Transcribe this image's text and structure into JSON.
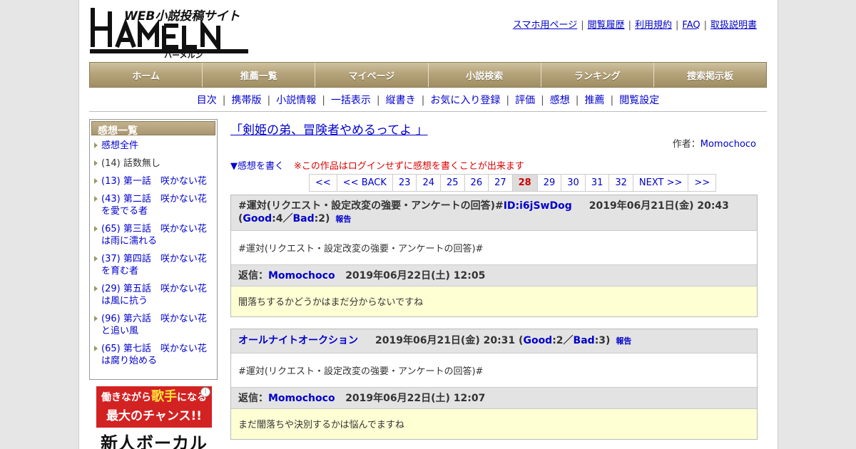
{
  "logo": {
    "tagline": "WEB小説投稿サイト",
    "name": "HAMELN",
    "kana": "ハーメルン"
  },
  "top_links": [
    "スマホ用ページ",
    "閲覧履歴",
    "利用規約",
    "FAQ",
    "取扱説明書"
  ],
  "global_nav": [
    "ホーム",
    "推薦一覧",
    "マイページ",
    "小説検索",
    "ランキング",
    "捜索掲示板"
  ],
  "sub_nav": [
    "目次",
    "携帯版",
    "小説情報",
    "一括表示",
    "縦書き",
    "お気に入り登録",
    "評価",
    "感想",
    "推薦",
    "閲覧設定"
  ],
  "sidebar": {
    "title": "感想一覧",
    "items": [
      {
        "label": "感想全件",
        "link": true
      },
      {
        "label": "(14) 話数無し",
        "link": false
      },
      {
        "label": "(13) 第一話　咲かない花",
        "link": true
      },
      {
        "label": "(43) 第二話　咲かない花を愛でる者",
        "link": true
      },
      {
        "label": "(65) 第三話　咲かない花は雨に濡れる",
        "link": true
      },
      {
        "label": "(37) 第四話　咲かない花を育む者",
        "link": true
      },
      {
        "label": "(29) 第五話　咲かない花は風に抗う",
        "link": true
      },
      {
        "label": "(96) 第六話　咲かない花と追い風",
        "link": true
      },
      {
        "label": "(65) 第七話　咲かない花は腐り始める",
        "link": true
      }
    ]
  },
  "ad": {
    "line1a": "働きながら",
    "line1b": "歌手",
    "line1c": "になる",
    "line2": "最大のチャンス!!",
    "line3": "新人ボーカル",
    "info": "i"
  },
  "work": {
    "title": "「剣姫の弟、冒険者やめるってよ 」",
    "author_label": "作者：",
    "author": "Momochoco",
    "write_link": "▼感想を書く",
    "notice": "※この作品はログインせずに感想を書くことが出来ます"
  },
  "pager": [
    "<<",
    "<< BACK",
    "23",
    "24",
    "25",
    "26",
    "27",
    "28",
    "29",
    "30",
    "31",
    "32",
    "NEXT >>",
    ">>"
  ],
  "pager_current": "28",
  "reviews": [
    {
      "head_text": "#運対(リクエスト・設定改変の強要・アンケートの回答)#",
      "user": "ID:i6jSwDog",
      "date": "2019年06月21日(金) 20:43",
      "good_label": "Good",
      "good": ":4／",
      "bad_label": "Bad",
      "bad": ":2)",
      "open_paren": "(",
      "report": "報告",
      "body": "#運対(リクエスト・設定改変の強要・アンケートの回答)#",
      "reply_label": "返信：",
      "reply_user": "Momochoco",
      "reply_date": "2019年06月22日(土) 12:05",
      "reply_body": "闇落ちするかどうかはまだ分からないですね"
    },
    {
      "user": "オールナイトオークション",
      "date": "2019年06月21日(金) 20:31",
      "good_label": "Good",
      "good": ":2／",
      "bad_label": "Bad",
      "bad": ":3)",
      "open_paren": "(",
      "report": "報告",
      "body": "#運対(リクエスト・設定改変の強要・アンケートの回答)#",
      "reply_label": "返信：",
      "reply_user": "Momochoco",
      "reply_date": "2019年06月22日(土) 12:07",
      "reply_body": "まだ闇落ちや決別するかは悩んでますね"
    }
  ],
  "colors": {
    "link": "#0000cc",
    "nav_gold": "#b5a37a",
    "reply_bg": "#ffffd4",
    "notice": "#dd0000"
  }
}
